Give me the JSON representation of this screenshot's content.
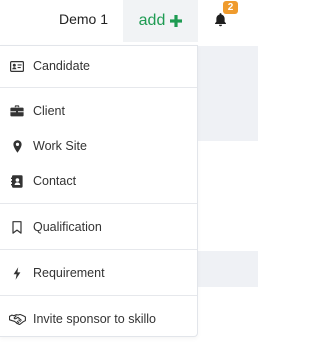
{
  "topbar": {
    "user_name": "Demo 1",
    "add_label": "add",
    "notification_count": "2",
    "icons": {
      "add": "plus-icon",
      "notifications": "bell-icon"
    },
    "colors": {
      "add_text": "#1e9b52",
      "badge": "#ef9b2d"
    }
  },
  "add_menu": {
    "items": [
      {
        "label": "Candidate",
        "icon": "id-card-icon"
      },
      {
        "label": "Client",
        "icon": "briefcase-icon"
      },
      {
        "label": "Work Site",
        "icon": "map-marker-icon"
      },
      {
        "label": "Contact",
        "icon": "address-book-icon"
      },
      {
        "label": "Qualification",
        "icon": "bookmark-icon"
      },
      {
        "label": "Requirement",
        "icon": "bolt-icon"
      },
      {
        "label": "Invite sponsor to skillo",
        "icon": "handshake-icon"
      }
    ]
  }
}
